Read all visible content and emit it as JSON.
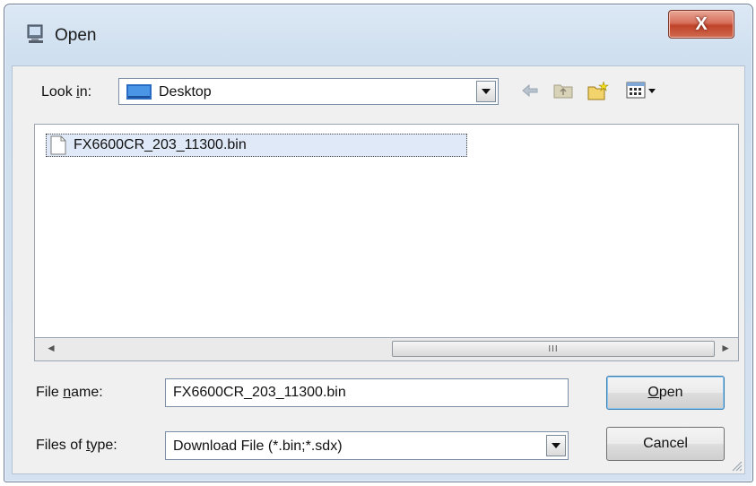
{
  "window": {
    "title": "Open",
    "close_label": "X"
  },
  "lookin": {
    "label_pre": "Look ",
    "label_accel": "i",
    "label_post": "n:",
    "value": "Desktop"
  },
  "toolbar": {
    "icons": [
      "back-arrow-icon",
      "up-folder-icon",
      "new-folder-icon",
      "view-menu-icon"
    ]
  },
  "files": [
    {
      "name": "FX6600CR_203_11300.bin",
      "selected": true
    }
  ],
  "scrollbar": {
    "left_arrow": "◄",
    "right_arrow": "►",
    "thumb_grip": "III"
  },
  "filename": {
    "label_pre": "File ",
    "label_accel": "n",
    "label_post": "ame:",
    "value": "FX6600CR_203_11300.bin"
  },
  "filetype": {
    "label_pre": "Files of ",
    "label_accel": "t",
    "label_post": "ype:",
    "value": "Download File (*.bin;*.sdx)"
  },
  "buttons": {
    "open_accel": "O",
    "open_rest": "pen",
    "cancel": "Cancel"
  },
  "colors": {
    "titlebar": "#d3e1f0",
    "close": "#c04329",
    "selection": "#dfe9f7"
  }
}
